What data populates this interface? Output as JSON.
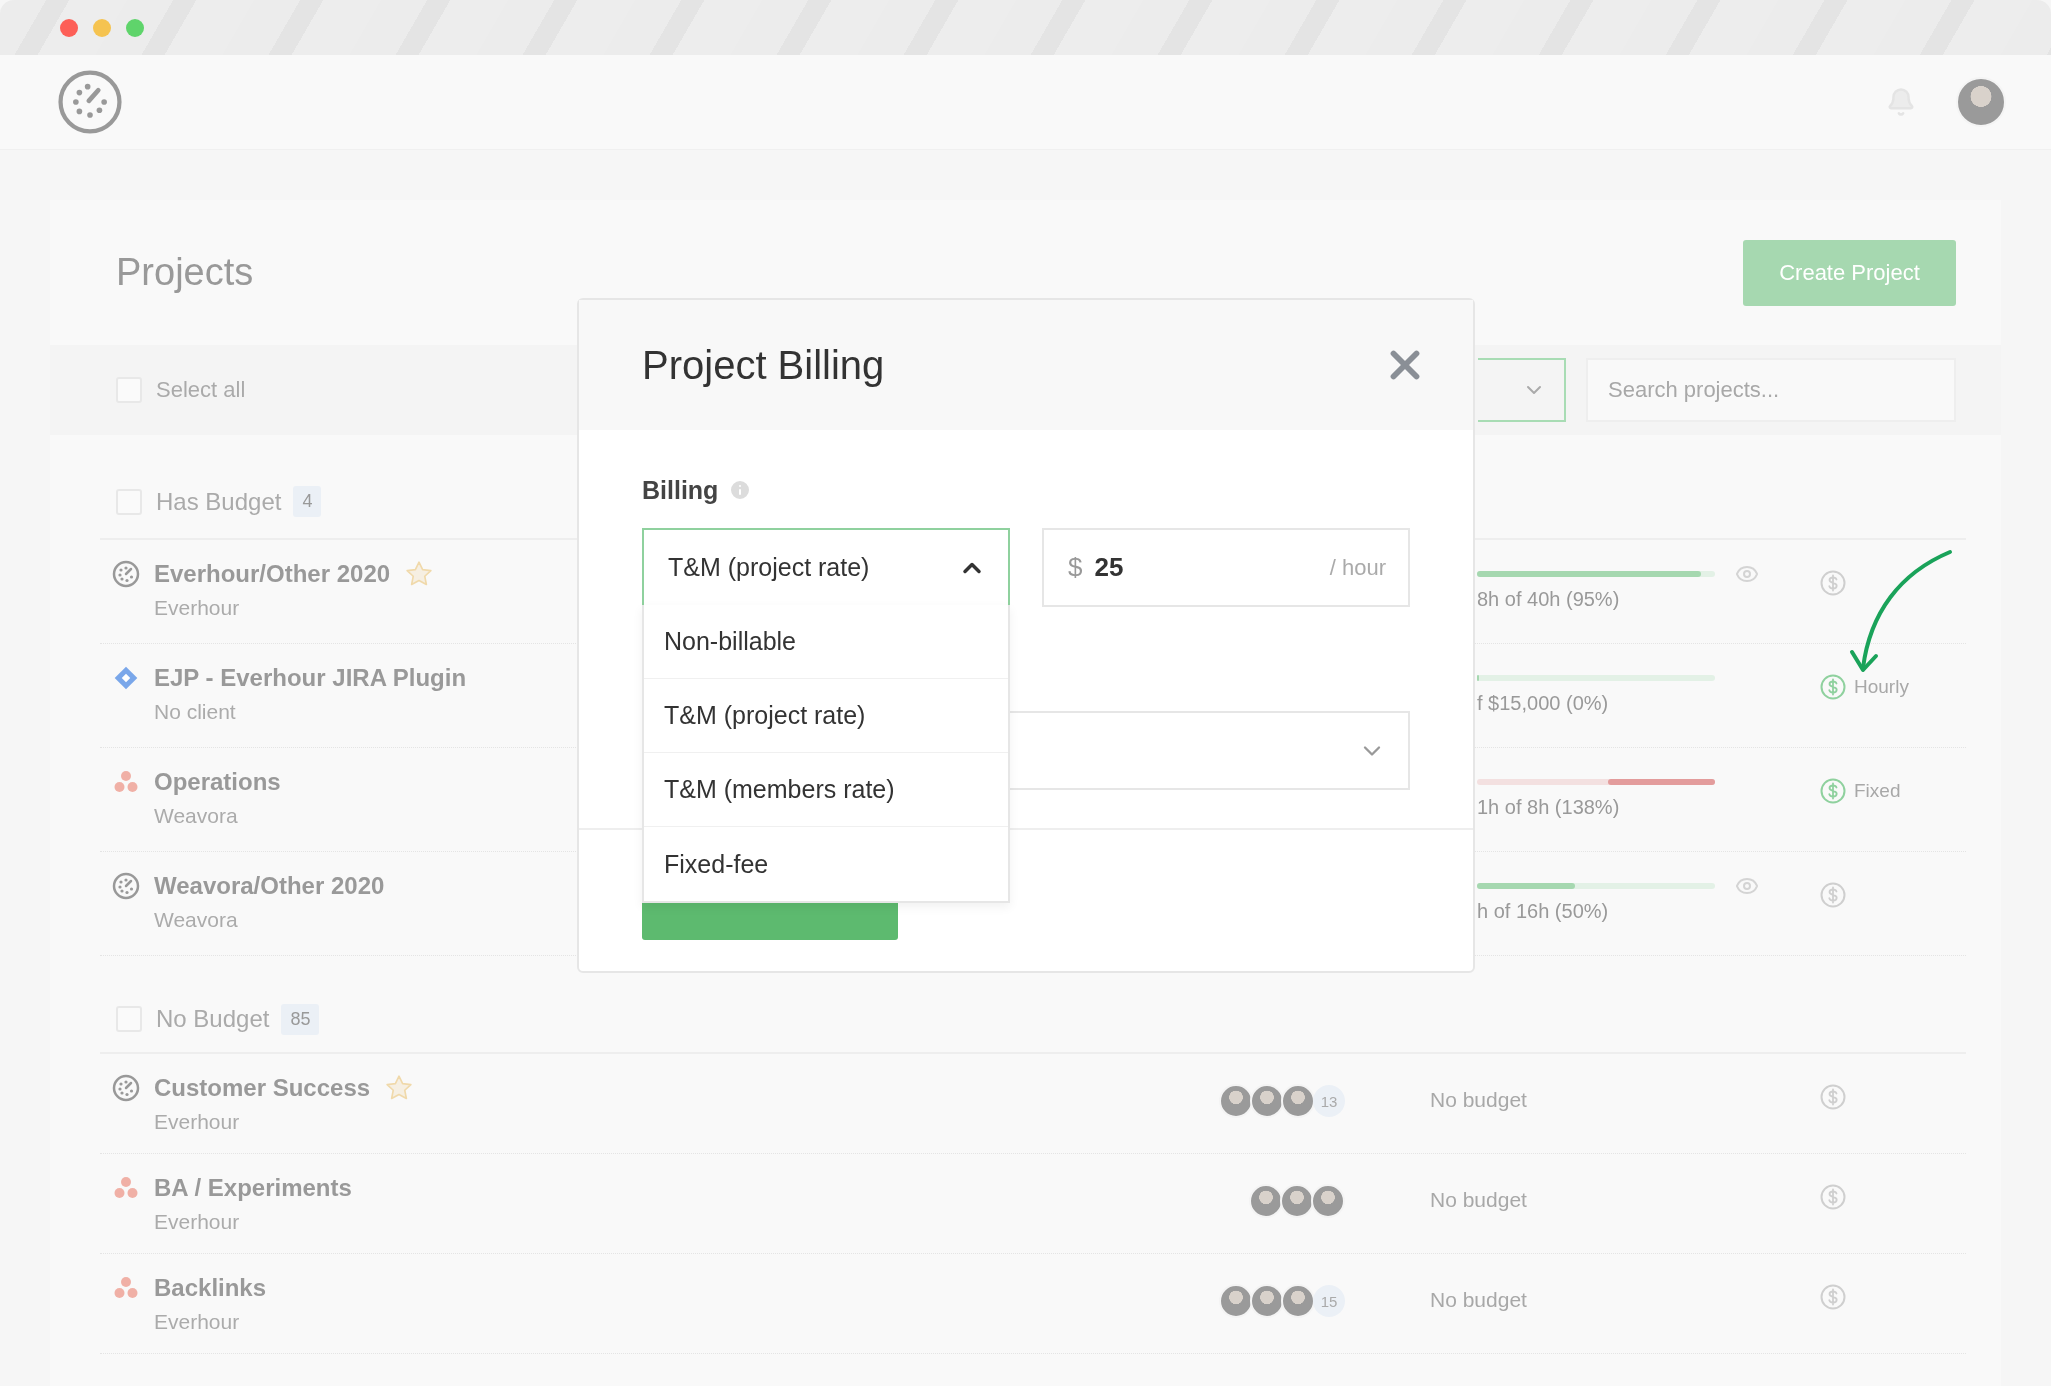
{
  "window": {
    "controls": [
      {
        "color": "#fd5f57"
      },
      {
        "color": "#f5c350"
      },
      {
        "color": "#5fd46b"
      }
    ]
  },
  "page": {
    "title": "Projects",
    "create_button": "Create Project"
  },
  "toolbar": {
    "select_all": {
      "label": "Select all",
      "checked": false
    },
    "search": {
      "placeholder": "Search projects..."
    }
  },
  "groups": [
    {
      "label": "Has Budget",
      "count": "4",
      "checked": false,
      "projects": [
        {
          "kind": "everhour",
          "name": "Everhour/Other 2020",
          "client": "Everhour",
          "starred": true,
          "budget": {
            "kind": "bar",
            "level": 0.94,
            "over": false,
            "watching": true,
            "text": "8h of 40h (95%)"
          },
          "billing": {
            "active": false
          }
        },
        {
          "kind": "jira",
          "name": "EJP - Everhour JIRA Plugin",
          "client": "No client",
          "starred": false,
          "budget": {
            "kind": "bar",
            "level": 0,
            "over": false,
            "watching": false,
            "text": "f $15,000 (0%)"
          },
          "billing": {
            "active": true,
            "label": "Hourly"
          }
        },
        {
          "kind": "asana",
          "name": "Operations",
          "client": "Weavora",
          "starred": false,
          "budget": {
            "kind": "bar",
            "level": 0.45,
            "over": true,
            "watching": false,
            "text": "1h of 8h (138%)"
          },
          "billing": {
            "active": true,
            "label": "Fixed"
          }
        },
        {
          "kind": "everhour",
          "name": "Weavora/Other 2020",
          "client": "Weavora",
          "starred": false,
          "budget": {
            "kind": "bar",
            "level": 0.41,
            "over": false,
            "watching": true,
            "text": "h of 16h (50%)"
          },
          "billing": {
            "active": false
          }
        }
      ]
    },
    {
      "label": "No Budget",
      "count": "85",
      "checked": false,
      "projects": [
        {
          "kind": "everhour",
          "name": "Customer Success",
          "client": "Everhour",
          "starred": true,
          "members": {
            "more": "13"
          },
          "budget": {
            "kind": "none",
            "text": "No budget"
          },
          "billing": {
            "active": false
          }
        },
        {
          "kind": "asana",
          "name": "BA / Experiments",
          "client": "Everhour",
          "starred": false,
          "budget": {
            "kind": "none",
            "text": "No budget"
          },
          "billing": {
            "active": false
          }
        },
        {
          "kind": "asana",
          "name": "Backlinks",
          "client": "Everhour",
          "starred": false,
          "members": {
            "more": "15"
          },
          "budget": {
            "kind": "none",
            "text": "No budget"
          },
          "billing": {
            "active": false
          }
        }
      ]
    }
  ],
  "modal": {
    "title": "Project Billing",
    "billing_label": "Billing",
    "select": {
      "value": "T&M (project rate)",
      "expanded": true
    },
    "rate": {
      "currency": "$",
      "value": "25",
      "unit": "/ hour"
    },
    "options": [
      {
        "label": "Non-billable"
      },
      {
        "label": "T&M (project rate)"
      },
      {
        "label": "T&M (members rate)"
      },
      {
        "label": "Fixed-fee"
      }
    ]
  }
}
